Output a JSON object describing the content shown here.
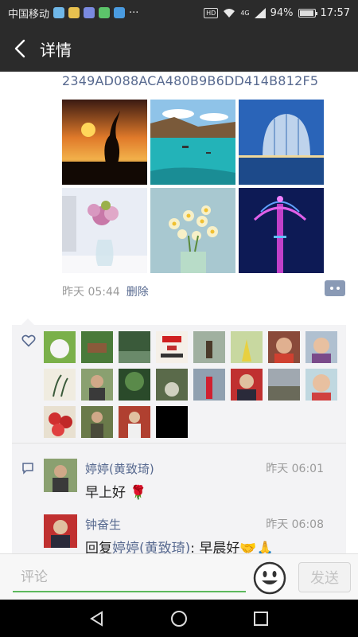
{
  "status": {
    "carrier": "中国移动",
    "battery": "94%",
    "time": "17:57",
    "hd": "HD",
    "signal_label": "4G"
  },
  "header": {
    "title": "详情",
    "back_icon": "chevron-left-icon"
  },
  "post": {
    "text_tail": "2349AD088ACA480B9B6DD414B812F5",
    "photos": [
      "heron-sunset-silhouette",
      "turquoise-lake-boats",
      "glass-sphere-hotel",
      "pink-flowers-vase",
      "narcissus-bouquet",
      "lit-tower-night"
    ],
    "time": "昨天 05:44",
    "delete_label": "删除"
  },
  "likes": {
    "icon": "heart-outline-icon",
    "avatars": [
      "white-cat",
      "garden-pavilion",
      "park-trees",
      "text-card-红",
      "woman-bridge",
      "woman-yellow-dress",
      "smiling-woman",
      "woman-glasses",
      "bamboo-painting",
      "man-tree",
      "pine-garden",
      "teapot",
      "woman-red-coat",
      "man-suit",
      "street-scene",
      "woman-portrait",
      "red-apples",
      "man-outdoors",
      "man-with-child",
      "black"
    ]
  },
  "comments": [
    {
      "name": "婷婷(黄致琦)",
      "time": "昨天 06:01",
      "text": "早上好 🌹"
    },
    {
      "name": "钟奋生",
      "time": "昨天 06:08",
      "reply_prefix": "回复",
      "reply_to": "婷婷(黄致琦)",
      "text": ": 早晨好🤝🙏"
    }
  ],
  "composer": {
    "placeholder": "评论",
    "send_label": "发送"
  },
  "colors": {
    "bar": "#2b2b2b",
    "link": "#57698f",
    "accent_green": "#5cb85c"
  }
}
